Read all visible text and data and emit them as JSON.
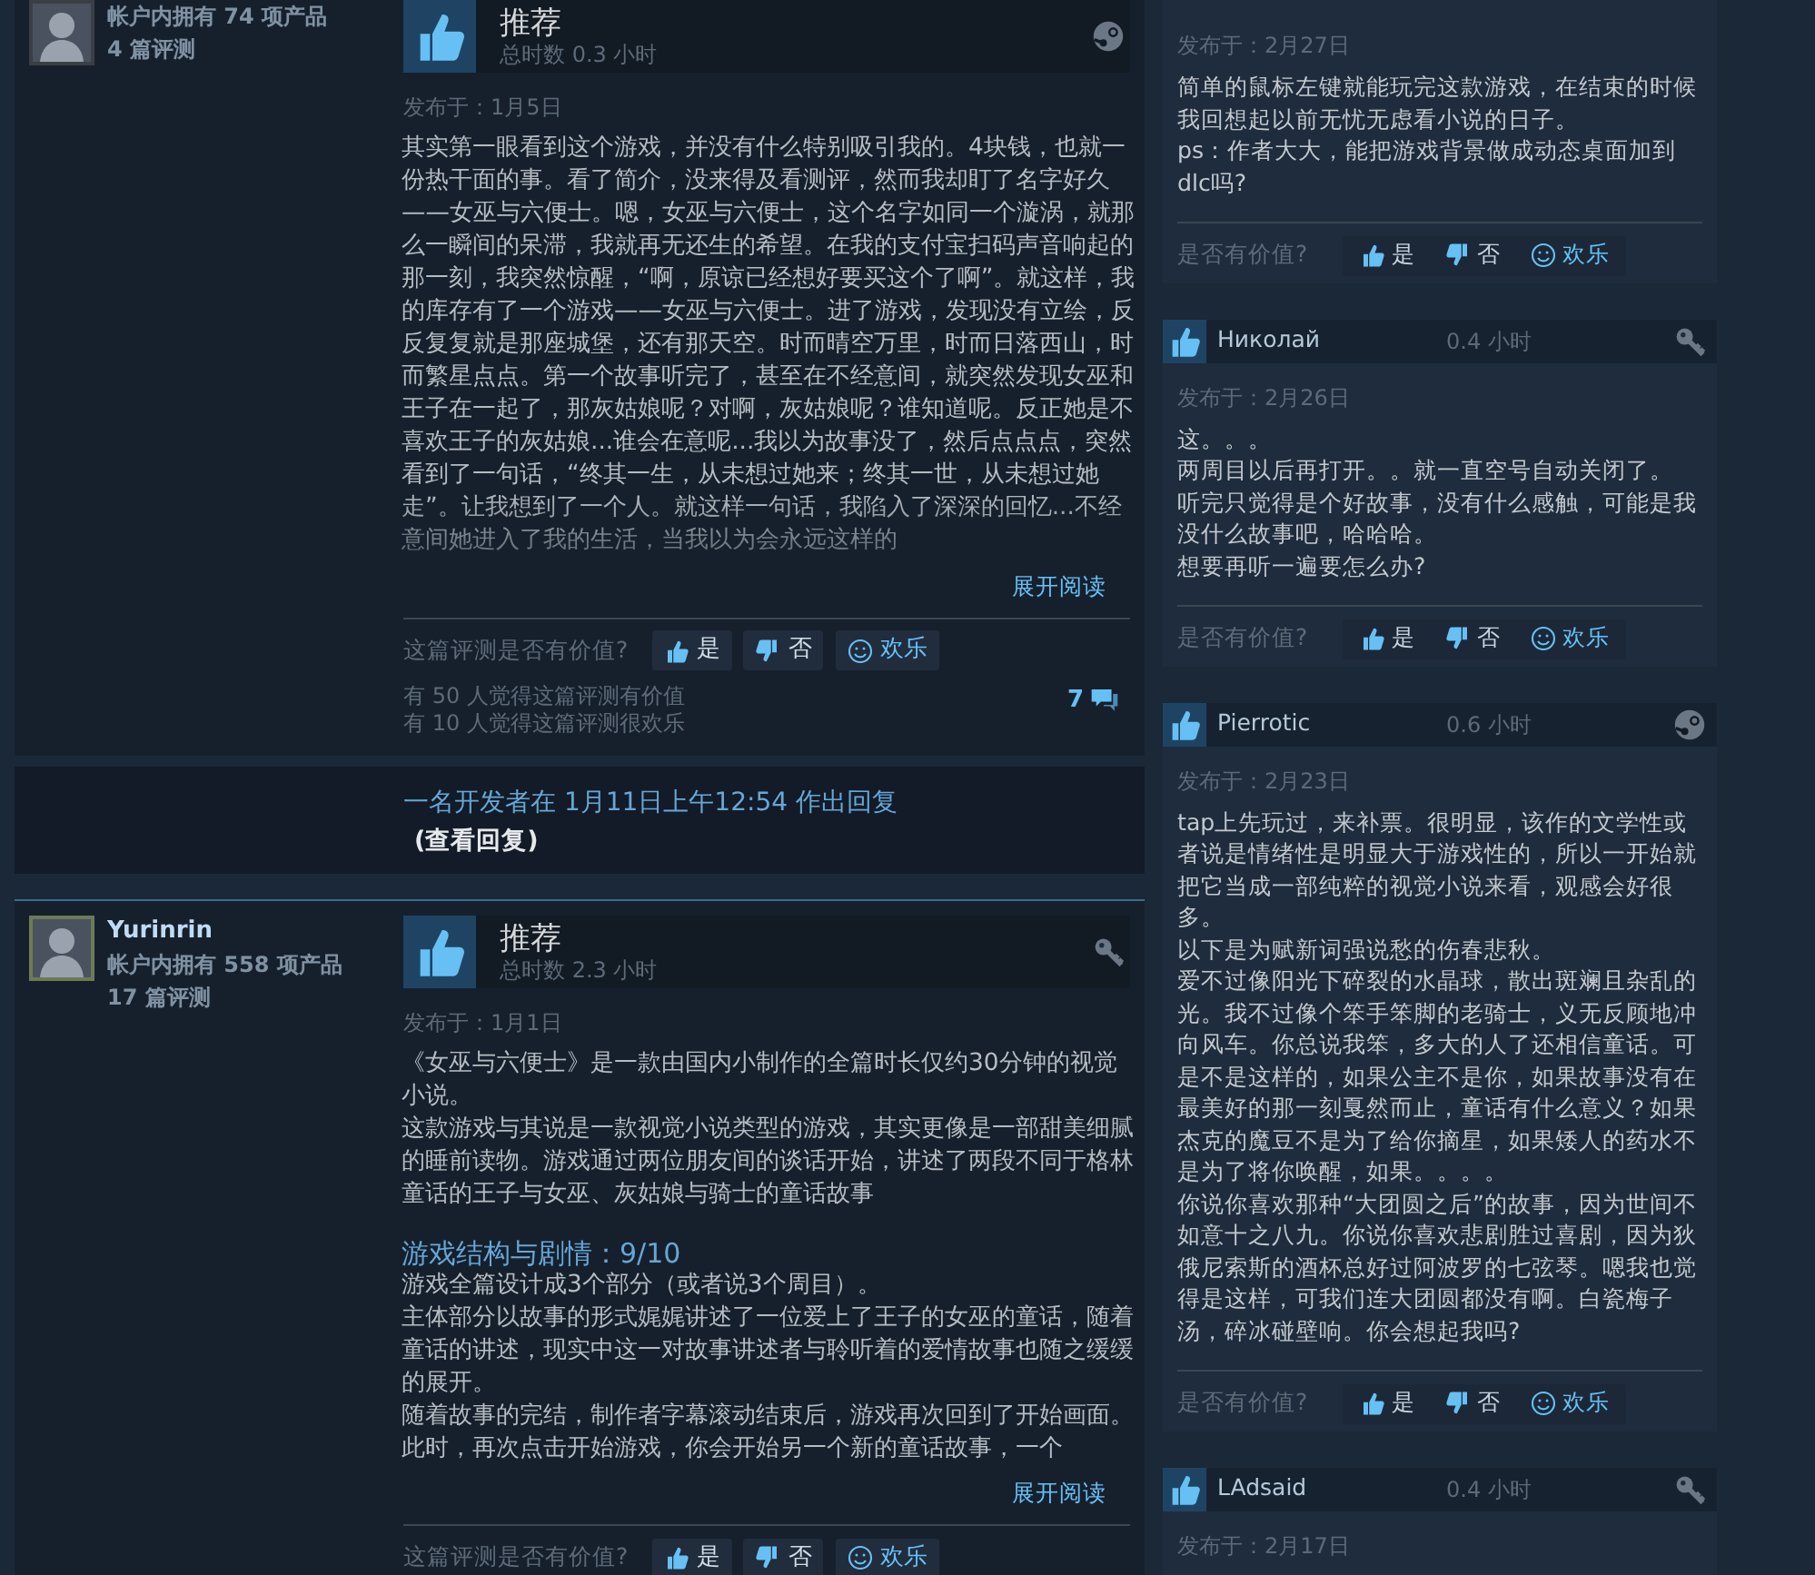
{
  "main_reviews": [
    {
      "author": {
        "products": "帐户内拥有 74 项产品",
        "reviews": "4 篇评测"
      },
      "verdict": "推荐",
      "recommended": true,
      "playtime": "总时数 0.3 小时",
      "kind": "steam",
      "posted": "发布于：1月5日",
      "paragraphs": [
        {
          "kind": "text",
          "text": "其实第一眼看到这个游戏，并没有什么特别吸引我的。4块钱，也就一份热干面的事。看了简介，没来得及看测评，然而我却盯了名字好久——女巫与六便士。嗯，女巫与六便士，这个名字如同一个漩涡，就那么一瞬间的呆滞，我就再无还生的希望。在我的支付宝扫码声音响起的那一刻，我突然惊醒，“啊，原谅已经想好要买这个了啊”。就这样，我的库存有了一个游戏——女巫与六便士。进了游戏，发现没有立绘，反反复复就是那座城堡，还有那天空。时而晴空万里，时而日落西山，时而繁星点点。第一个故事听完了，甚至在不经意间，就突然发现女巫和王子在一起了，那灰姑娘呢？对啊，灰姑娘呢？谁知道呢。反正她是不喜欢王子的灰姑娘...谁会在意呢...我以为故事没了，然后点点点，突然看到了一句话，“终其一生，从未想过她来；终其一世，从未想过她走”。让我想到了一个人。就这样一句话，我陷入了深深的回忆...不经意间她进入了我的生活，当我以为会永远这样的"
        }
      ],
      "read_more": "展开阅读",
      "helpful_prompt": "这篇评测是否有价值?",
      "votes": [
        {
          "kind": "up",
          "label": "是"
        },
        {
          "kind": "down",
          "label": "否"
        },
        {
          "kind": "funny",
          "label": "欢乐"
        }
      ],
      "stats": [
        "有 50 人觉得这篇评测有价值",
        "有 10 人觉得这篇评测很欢乐"
      ],
      "comment_count": "7",
      "developer_response": {
        "text": "一名开发者在 1月11日上午12:54 作出回复",
        "link": "(查看回复)"
      }
    },
    {
      "author": {
        "name": "Yurinrin",
        "products": "帐户内拥有 558 项产品",
        "reviews": "17 篇评测"
      },
      "verdict": "推荐",
      "recommended": true,
      "playtime": "总时数 2.3 小时",
      "kind": "key",
      "posted": "发布于：1月1日",
      "paragraphs": [
        {
          "kind": "text",
          "text": "《女巫与六便士》是一款由国内小制作的全篇时长仅约30分钟的视觉小说。"
        },
        {
          "kind": "text",
          "text": "这款游戏与其说是一款视觉小说类型的游戏，其实更像是一部甜美细腻的睡前读物。游戏通过两位朋友间的谈话开始，讲述了两段不同于格林童话的王子与女巫、灰姑娘与骑士的童话故事"
        },
        {
          "kind": "heading",
          "text": "游戏结构与剧情：9/10"
        },
        {
          "kind": "text",
          "text": "游戏全篇设计成3个部分（或者说3个周目）。"
        },
        {
          "kind": "text",
          "text": "主体部分以故事的形式娓娓讲述了一位爱上了王子的女巫的童话，随着童话的讲述，现实中这一对故事讲述者与聆听着的爱情故事也随之缓缓的展开。"
        },
        {
          "kind": "text",
          "text": "随着故事的完结，制作者字幕滚动结束后，游戏再次回到了开始画面。此时，再次点击开始游戏，你会开始另一个新的童话故事，一个"
        }
      ],
      "read_more": "展开阅读",
      "helpful_prompt": "这篇评测是否有价值?",
      "votes": [
        {
          "kind": "up",
          "label": "是"
        },
        {
          "kind": "down",
          "label": "否"
        },
        {
          "kind": "funny",
          "label": "欢乐"
        }
      ]
    }
  ],
  "side_reviews": [
    {
      "posted": "发布于：2月27日",
      "paragraphs": [
        "简单的鼠标左键就能玩完这款游戏，在结束的时候我回想起以前无忧无虑看小说的日子。",
        "ps：作者大大，能把游戏背景做成动态桌面加到dlc吗?"
      ],
      "helpful_prompt": "是否有价值?",
      "votes": [
        {
          "kind": "up",
          "label": "是"
        },
        {
          "kind": "down",
          "label": "否"
        },
        {
          "kind": "funny",
          "label": "欢乐"
        }
      ]
    },
    {
      "recommended": true,
      "name": "Николай",
      "hours": "0.4 小时",
      "kind": "key",
      "posted": "发布于：2月26日",
      "paragraphs": [
        "这。。。",
        "两周目以后再打开。。就一直空号自动关闭了。",
        "听完只觉得是个好故事，没有什么感触，可能是我没什么故事吧，哈哈哈。",
        "想要再听一遍要怎么办?"
      ],
      "helpful_prompt": "是否有价值?",
      "votes": [
        {
          "kind": "up",
          "label": "是"
        },
        {
          "kind": "down",
          "label": "否"
        },
        {
          "kind": "funny",
          "label": "欢乐"
        }
      ]
    },
    {
      "recommended": true,
      "name": "Pierrotic",
      "hours": "0.6 小时",
      "kind": "steam",
      "posted": "发布于：2月23日",
      "paragraphs": [
        "tap上先玩过，来补票。很明显，该作的文学性或者说是情绪性是明显大于游戏性的，所以一开始就把它当成一部纯粹的视觉小说来看，观感会好很多。",
        "以下是为赋新词强说愁的伤春悲秋。",
        "爱不过像阳光下碎裂的水晶球，散出斑斓且杂乱的光。我不过像个笨手笨脚的老骑士，义无反顾地冲向风车。你总说我笨，多大的人了还相信童话。可是不是这样的，如果公主不是你，如果故事没有在最美好的那一刻戛然而止，童话有什么意义？如果杰克的魔豆不是为了给你摘星，如果矮人的药水不是为了将你唤醒，如果。。。。",
        "你说你喜欢那种“大团圆之后”的故事，因为世间不如意十之八九。你说你喜欢悲剧胜过喜剧，因为狄俄尼索斯的酒杯总好过阿波罗的七弦琴。嗯我也觉得是这样，可我们连大团圆都没有啊。白瓷梅子汤，碎冰碰壁响。你会想起我吗?"
      ],
      "helpful_prompt": "是否有价值?",
      "votes": [
        {
          "kind": "up",
          "label": "是"
        },
        {
          "kind": "down",
          "label": "否"
        },
        {
          "kind": "funny",
          "label": "欢乐"
        }
      ]
    },
    {
      "recommended": true,
      "name": "LAdsaid",
      "hours": "0.4 小时",
      "kind": "key",
      "posted": "发布于：2月17日"
    }
  ]
}
